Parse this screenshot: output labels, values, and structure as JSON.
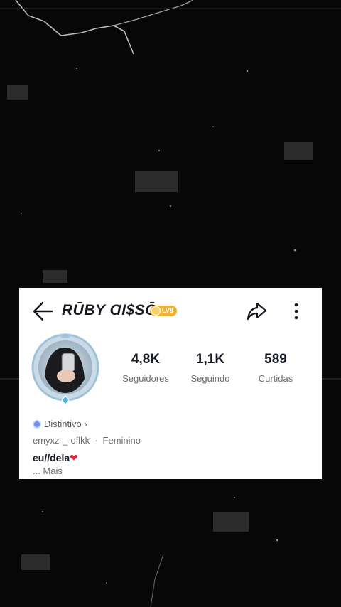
{
  "profile": {
    "username": "RŪBY ⱭI$SŌ",
    "level_badge": "LV8",
    "stats": [
      {
        "value": "4,8K",
        "label": "Seguidores"
      },
      {
        "value": "1,1K",
        "label": "Seguindo"
      },
      {
        "value": "589",
        "label": "Curtidas"
      }
    ],
    "badge_label": "Distintivo",
    "handle": "emyxz-_-oflkk",
    "gender": "Feminino",
    "bio": "eu//dela",
    "bio_emoji": "❤",
    "more_label": "...  Mais"
  },
  "icons": [
    "back-arrow-icon",
    "share-icon",
    "more-options-icon",
    "chevron-right-icon",
    "badge-icon",
    "heart-icon"
  ],
  "colors": {
    "level_badge": "#e9b43a",
    "heart": "#e0263b",
    "badge_icon": "#6f8cf6",
    "background": "#070707"
  }
}
